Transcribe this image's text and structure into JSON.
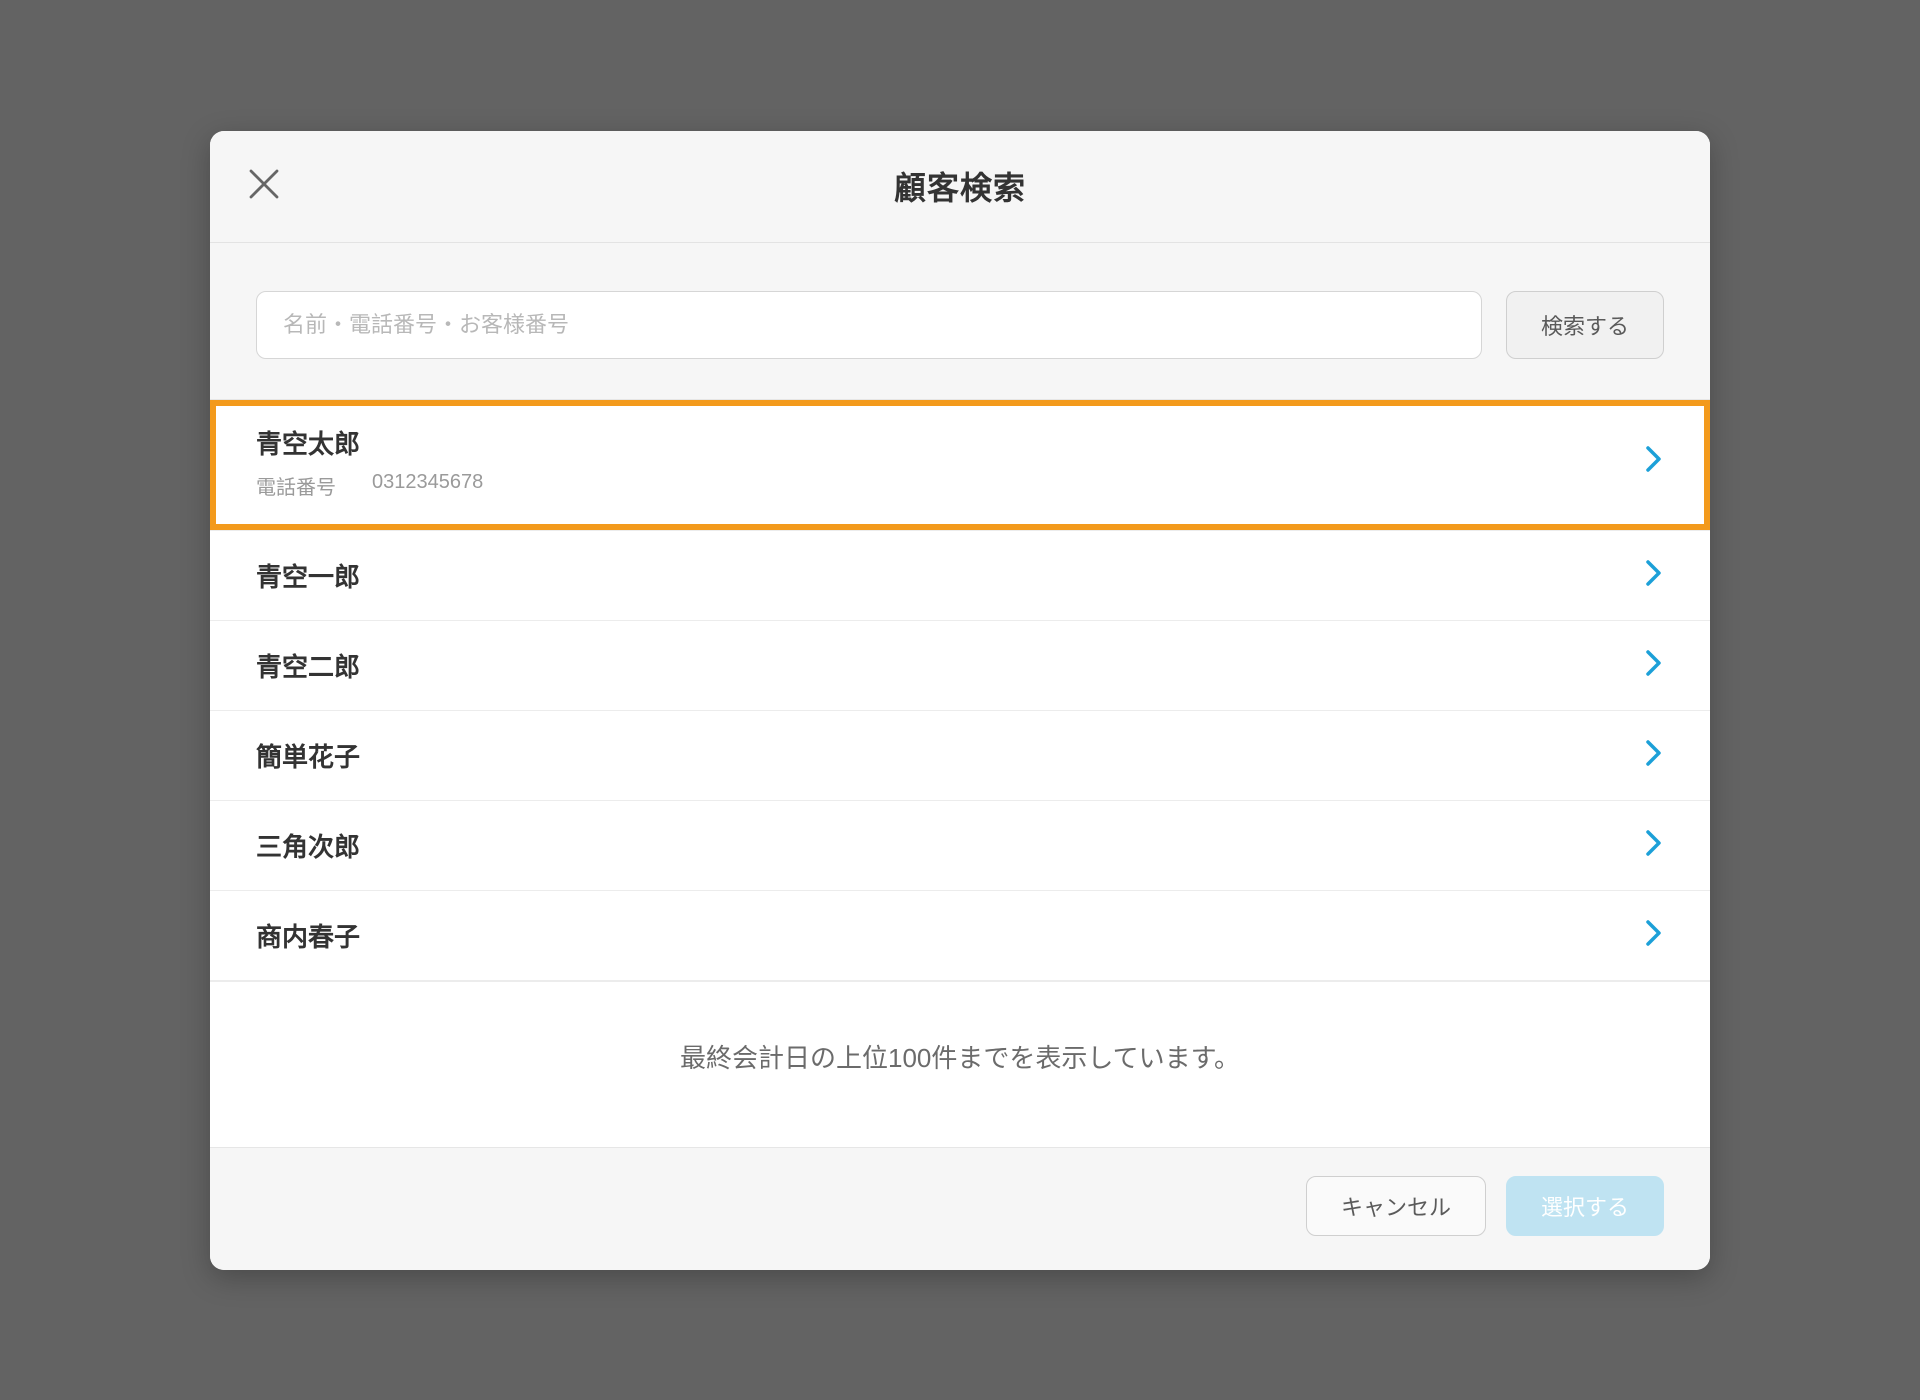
{
  "modal": {
    "title": "顧客検索",
    "search": {
      "placeholder": "名前・電話番号・お客様番号",
      "button": "検索する"
    },
    "results": [
      {
        "name": "青空太郎",
        "phone_label": "電話番号",
        "phone_value": "0312345678",
        "highlighted": true
      },
      {
        "name": "青空一郎"
      },
      {
        "name": "青空二郎"
      },
      {
        "name": "簡単花子"
      },
      {
        "name": "三角次郎"
      },
      {
        "name": "商内春子"
      }
    ],
    "footnote": "最終会計日の上位100件までを表示しています。",
    "footer": {
      "cancel": "キャンセル",
      "select": "選択する"
    }
  }
}
